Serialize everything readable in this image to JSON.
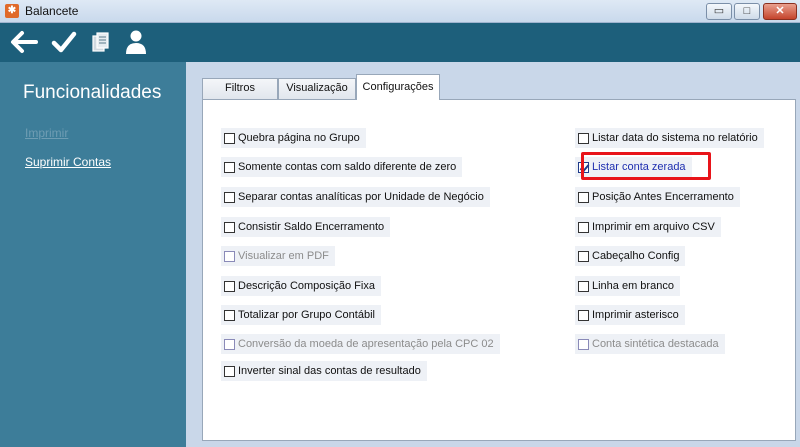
{
  "window": {
    "title": "Balancete",
    "app_icon_glyph": "✱",
    "buttons": {
      "minimize": "▭",
      "maximize": "□",
      "close": "✕"
    }
  },
  "toolbar": {
    "icons": [
      "back-arrow-icon",
      "checkmark-icon",
      "documents-icon",
      "user-icon"
    ],
    "color": "#1d5f7b"
  },
  "sidebar": {
    "title": "Funcionalidades",
    "links": [
      {
        "label": "Imprimir",
        "disabled": true
      },
      {
        "label": "Suprimir Contas",
        "disabled": false
      }
    ],
    "color": "#3d7d99"
  },
  "tabs": [
    {
      "label": "Filtros",
      "active": false
    },
    {
      "label": "Visualização",
      "active": false
    },
    {
      "label": "Configurações",
      "active": true
    }
  ],
  "options_left": [
    {
      "label": "Quebra página no Grupo",
      "checked": false,
      "disabled": false
    },
    {
      "label": "Somente contas com saldo diferente de zero",
      "checked": false,
      "disabled": false
    },
    {
      "label": "Separar contas analíticas por Unidade de Negócio",
      "checked": false,
      "disabled": false
    },
    {
      "label": "Consistir Saldo Encerramento",
      "checked": false,
      "disabled": false
    },
    {
      "label": "Visualizar em PDF",
      "checked": false,
      "disabled": true
    },
    {
      "label": "Descrição Composição Fixa",
      "checked": false,
      "disabled": false
    },
    {
      "label": "Totalizar por Grupo Contábil",
      "checked": false,
      "disabled": false
    },
    {
      "label": "Conversão da moeda de apresentação pela CPC 02",
      "checked": false,
      "disabled": true
    },
    {
      "label": "Inverter sinal das contas de resultado",
      "checked": false,
      "disabled": false
    }
  ],
  "options_right": [
    {
      "label": "Listar data do sistema no relatório",
      "checked": false,
      "disabled": false
    },
    {
      "label": "Listar conta zerada",
      "checked": true,
      "disabled": false,
      "highlighted": true
    },
    {
      "label": "Posição Antes Encerramento",
      "checked": false,
      "disabled": false
    },
    {
      "label": "Imprimir em arquivo CSV",
      "checked": false,
      "disabled": false
    },
    {
      "label": "Cabeçalho Config",
      "checked": false,
      "disabled": false
    },
    {
      "label": "Linha em branco",
      "checked": false,
      "disabled": false
    },
    {
      "label": "Imprimir asterisco",
      "checked": false,
      "disabled": false
    },
    {
      "label": "Conta sintética destacada",
      "checked": false,
      "disabled": true
    }
  ],
  "highlight_color": "#e8141a"
}
